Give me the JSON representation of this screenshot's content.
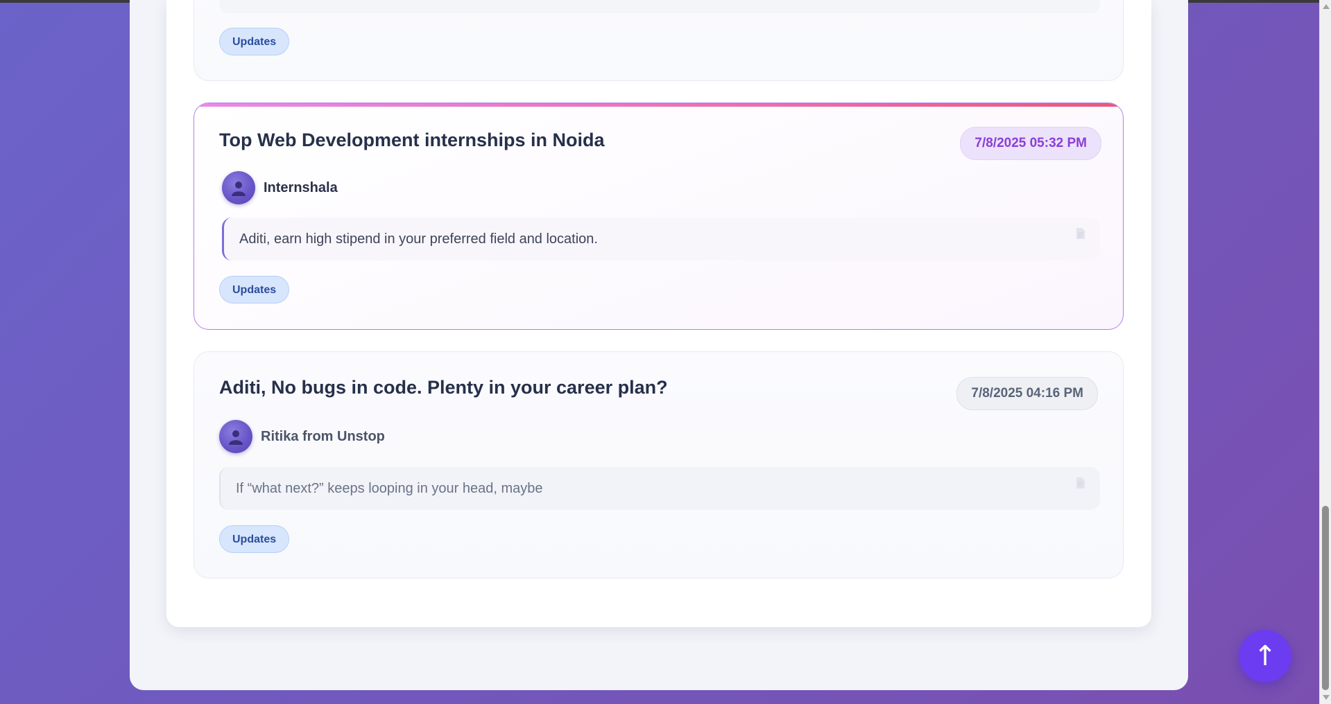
{
  "emails": [
    {
      "tag": "Updates"
    },
    {
      "title": "Top Web Development internships in Noida",
      "date": "7/8/2025 05:32 PM",
      "sender": "Internshala",
      "snippet": "Aditi, earn high stipend in your preferred field and location.",
      "tag": "Updates"
    },
    {
      "title": "Aditi, No bugs in code. Plenty in your career plan?",
      "date": "7/8/2025 04:16 PM",
      "sender": "Ritika from Unstop",
      "snippet": "If “what next?” keeps looping in your head, maybe",
      "tag": "Updates"
    }
  ],
  "scroll_top_button": {
    "glyph": "↑"
  },
  "icons": {
    "avatar": "person-icon",
    "snippet": "document-icon",
    "scroll_top": "arrow-up-icon"
  },
  "colors": {
    "accent_purple": "#8a3fd6",
    "tag_blue": "#d7e6fd",
    "scroll_button": "#6c3cf0",
    "highlight_border": "#b67ce6"
  }
}
